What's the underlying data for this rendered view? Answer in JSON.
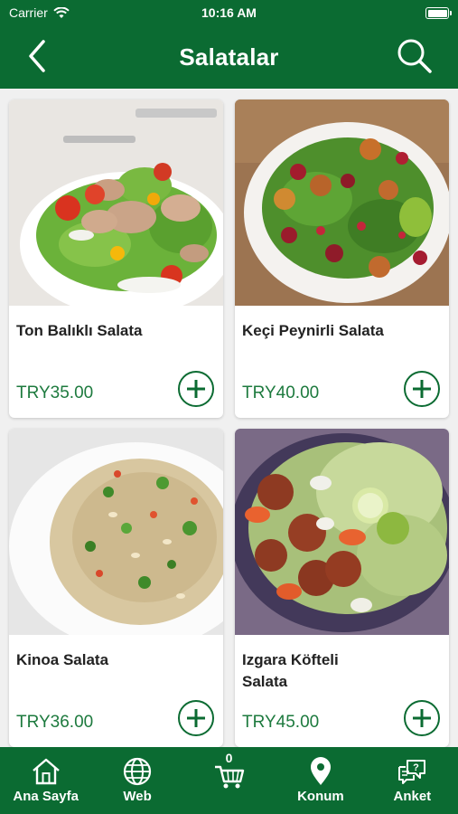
{
  "status_bar": {
    "carrier": "Carrier",
    "time": "10:16 AM"
  },
  "header": {
    "title": "Salatalar",
    "back_icon": "chevron-left-icon",
    "search_icon": "search-icon"
  },
  "products": [
    {
      "name": "Ton Balıklı Salata",
      "price": "TRY35.00"
    },
    {
      "name": "Keçi Peynirli Salata",
      "price": "TRY40.00"
    },
    {
      "name": "Kinoa Salata",
      "price": "TRY36.00"
    },
    {
      "name": "Izgara Köfteli Salata",
      "price": "TRY45.00"
    }
  ],
  "tabbar": {
    "home": "Ana Sayfa",
    "web": "Web",
    "cart_count": "0",
    "location": "Konum",
    "survey": "Anket"
  },
  "colors": {
    "primary": "#0b6b32",
    "price": "#1d7a3e"
  }
}
